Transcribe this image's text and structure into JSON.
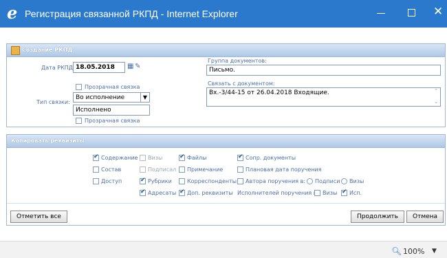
{
  "window": {
    "title": "Регистрация связанной РКПД - Internet Explorer",
    "icon": "ie-logo-icon",
    "controls": [
      "minimize-icon",
      "maximize-icon",
      "close-icon"
    ],
    "accent_color": "#2b79cc"
  },
  "create_panel": {
    "title": "Создание РКПД",
    "date_label": "Дата РКПД:",
    "date_value": "18.05.2018",
    "transparent_link_label": "Прозрачная связка",
    "link_type_label": "Тип связки:",
    "link_type_value": "Во исполнение",
    "link_type_text": "Исполнено",
    "transparent_link_label_2": "Прозрачная связка",
    "doc_group_label": "Группа документов:",
    "doc_group_value": "Письмо.",
    "link_with_doc_label": "Связать с документом:",
    "link_with_doc_value": "Вх.-3/44-15 от 26.04.2018 Входящие."
  },
  "copy_panel": {
    "title": "Копировать реквизиты",
    "options": {
      "content": {
        "label": "Содержание",
        "checked": true
      },
      "visas": {
        "label": "Визы",
        "checked": false
      },
      "files": {
        "label": "Файлы",
        "checked": true
      },
      "accompanying_docs": {
        "label": "Сопр. документы",
        "checked": true
      },
      "composition": {
        "label": "Состав",
        "checked": false
      },
      "signed": {
        "label": "Подписал",
        "checked": false
      },
      "note": {
        "label": "Примечание",
        "checked": false
      },
      "planned_date": {
        "label": "Плановая дата поручения",
        "checked": false
      },
      "access": {
        "label": "Доступ",
        "checked": false
      },
      "rubrics": {
        "label": "Рубрики",
        "checked": true
      },
      "correspondents": {
        "label": "Корреспонденты",
        "checked": false
      },
      "order_author": {
        "label": "Автора поручения в:",
        "checked": false
      },
      "addressees": {
        "label": "Адресаты",
        "checked": true
      },
      "extra_attrs": {
        "label": "Доп. реквизиты",
        "checked": true
      }
    },
    "radio_signatures": "Подписи",
    "radio_visas": "Визы",
    "executors_label": "Исполнителей поручения в:",
    "executors_visas": {
      "label": "Визы",
      "checked": false
    },
    "executors_exec": {
      "label": "Исп.",
      "checked": true
    }
  },
  "buttons": {
    "mark_all": "Отметить все",
    "continue": "Продолжить",
    "cancel": "Отмена"
  },
  "statusbar": {
    "zoom": "100%",
    "zoom_icon": "magnifier-icon"
  }
}
